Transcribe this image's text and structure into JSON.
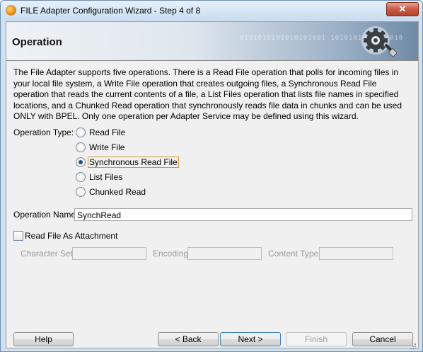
{
  "window": {
    "title": "FILE Adapter Configuration Wizard - Step 4 of 8",
    "close_label": "✕"
  },
  "header": {
    "title": "Operation",
    "binary_text": "0101010101010101001 1010101010101010"
  },
  "description": "The File Adapter supports five operations.  There is a Read File operation that polls for incoming files in your local file system, a Write File operation that creates outgoing files, a Synchronous Read File operation that reads the current contents of a file, a List Files operation that lists file names in specified locations, and a Chunked Read operation that synchronously reads file data in chunks and can be used ONLY with BPEL. Only one operation per Adapter Service may be defined using this wizard.",
  "operation_type": {
    "label": "Operation Type:",
    "options": [
      {
        "label": "Read File",
        "selected": false
      },
      {
        "label": "Write File",
        "selected": false
      },
      {
        "label": "Synchronous Read File",
        "selected": true
      },
      {
        "label": "List Files",
        "selected": false
      },
      {
        "label": "Chunked Read",
        "selected": false
      }
    ]
  },
  "operation_name": {
    "label": "Operation Name:",
    "value": "SynchRead"
  },
  "attachment": {
    "checkbox_label": "Read File As Attachment",
    "checked": false,
    "character_set_label": "Character Set:",
    "encoding_label": "Encoding:",
    "content_type_label": "Content Type:"
  },
  "buttons": {
    "help": "Help",
    "back": "< Back",
    "next": "Next >",
    "finish": "Finish",
    "cancel": "Cancel"
  }
}
